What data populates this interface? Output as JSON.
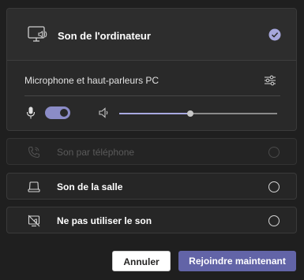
{
  "selected_option": {
    "title": "Son de l'ordinateur",
    "icon": "computer-audio-icon",
    "checked": true
  },
  "device": {
    "label": "Microphone et haut-parleurs PC",
    "settings_icon": "device-settings-icon",
    "mic_icon": "microphone-icon",
    "mic_enabled": true,
    "speaker_icon": "speaker-icon",
    "volume_level": 0.45
  },
  "options": [
    {
      "label": "Son par téléphone",
      "icon": "phone-icon",
      "disabled": true
    },
    {
      "label": "Son de la salle",
      "icon": "room-audio-icon",
      "disabled": false
    },
    {
      "label": "Ne pas utiliser le son",
      "icon": "no-audio-icon",
      "disabled": false
    }
  ],
  "buttons": {
    "cancel": "Annuler",
    "join": "Rejoindre maintenant"
  },
  "colors": {
    "accent": "#6264a7",
    "toggle_on": "#8b8cc7",
    "background": "#1f1f1f"
  }
}
